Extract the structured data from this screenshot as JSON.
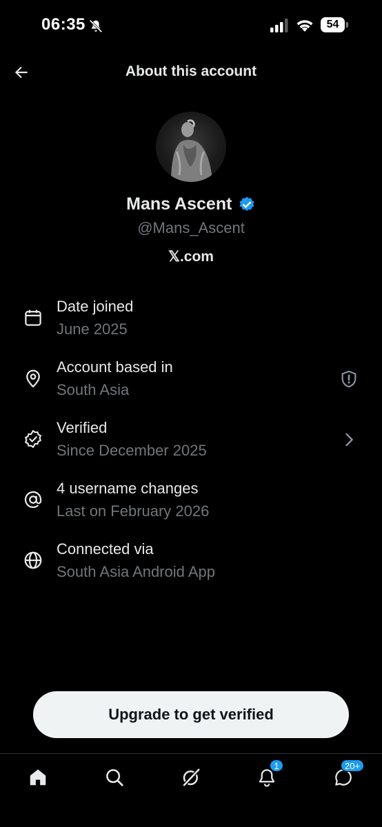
{
  "status_bar": {
    "time": "06:35",
    "battery": "54"
  },
  "header": {
    "title": "About this account"
  },
  "profile": {
    "display_name": "Mans Ascent",
    "handle": "@Mans_Ascent",
    "source": "𝕏.com",
    "verified_color": "#1d9bf0"
  },
  "info_items": [
    {
      "icon": "calendar-icon",
      "label": "Date joined",
      "value": "June 2025"
    },
    {
      "icon": "location-pin-icon",
      "label": "Account based in",
      "value": "South Asia",
      "trailing_icon": "shield-alert-icon"
    },
    {
      "icon": "verified-check-icon",
      "label": "Verified",
      "value": "Since December 2025",
      "trailing_icon": "chevron-right-icon"
    },
    {
      "icon": "at-sign-icon",
      "label": "4 username changes",
      "value": "Last on February 2026"
    },
    {
      "icon": "globe-icon",
      "label": "Connected via",
      "value": "South Asia Android App"
    }
  ],
  "cta": {
    "label": "Upgrade to get verified"
  },
  "bottom_nav": {
    "items": [
      {
        "icon": "home-icon"
      },
      {
        "icon": "search-icon"
      },
      {
        "icon": "grok-icon"
      },
      {
        "icon": "notifications-icon",
        "badge": "1"
      },
      {
        "icon": "messages-icon",
        "badge": "20+"
      }
    ]
  },
  "colors": {
    "background": "#000000",
    "primary_text": "#e7e9ea",
    "secondary_text": "#71767b",
    "accent": "#1d9bf0",
    "button_bg": "#eff3f4"
  }
}
